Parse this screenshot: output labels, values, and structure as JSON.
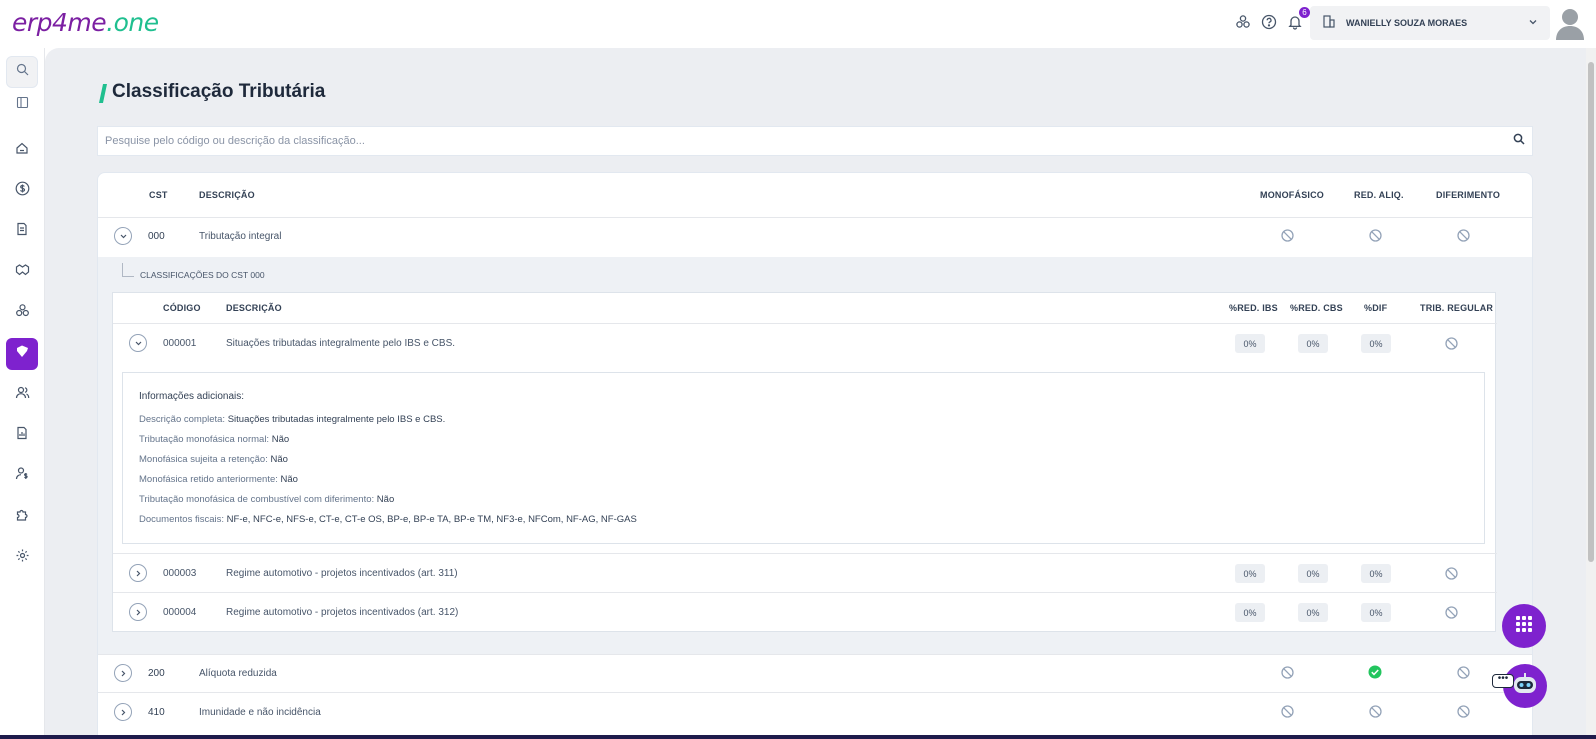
{
  "app": {
    "logo_part1": "erp4me",
    "logo_part2": ".one"
  },
  "topbar": {
    "notifications_count": "6",
    "user_name": "WANIELLY SOUZA MORAES"
  },
  "page": {
    "title": "Classificação Tributária",
    "search_placeholder": "Pesquise pelo código ou descrição da classificação..."
  },
  "table": {
    "headers": {
      "cst": "CST",
      "descricao": "DESCRIÇÃO",
      "monofasico": "MONOFÁSICO",
      "red_aliq": "RED. ALIQ.",
      "diferimento": "DIFERIMENTO"
    },
    "rows": [
      {
        "cst": "000",
        "descricao": "Tributação integral",
        "monofasico": "no",
        "red_aliq": "no",
        "diferimento": "no",
        "expanded": true
      },
      {
        "cst": "200",
        "descricao": "Alíquota reduzida",
        "monofasico": "no",
        "red_aliq": "yes",
        "diferimento": "no",
        "expanded": false
      },
      {
        "cst": "410",
        "descricao": "Imunidade e não incidência",
        "monofasico": "no",
        "red_aliq": "no",
        "diferimento": "no",
        "expanded": false
      }
    ]
  },
  "sub": {
    "label": "CLASSIFICAÇÕES DO CST 000",
    "headers": {
      "codigo": "CÓDIGO",
      "descricao": "DESCRIÇÃO",
      "red_ibs": "%RED. IBS",
      "red_cbs": "%RED. CBS",
      "dif": "%DIF",
      "trib_regular": "TRIB. REGULAR"
    },
    "rows": [
      {
        "codigo": "000001",
        "descricao": "Situações tributadas integralmente pelo IBS e CBS.",
        "red_ibs": "0%",
        "red_cbs": "0%",
        "dif": "0%"
      },
      {
        "codigo": "000003",
        "descricao": "Regime automotivo - projetos incentivados (art. 311)",
        "red_ibs": "0%",
        "red_cbs": "0%",
        "dif": "0%"
      },
      {
        "codigo": "000004",
        "descricao": "Regime automotivo - projetos incentivados (art. 312)",
        "red_ibs": "0%",
        "red_cbs": "0%",
        "dif": "0%"
      }
    ],
    "info": {
      "title": "Informações adicionais:",
      "lines": [
        {
          "label": "Descrição completa:",
          "value": "Situações tributadas integralmente pelo IBS e CBS."
        },
        {
          "label": "Tributação monofásica normal:",
          "value": "Não"
        },
        {
          "label": "Monofásica sujeita a retenção:",
          "value": "Não"
        },
        {
          "label": "Monofásica retido anteriormente:",
          "value": "Não"
        },
        {
          "label": "Tributação monofásica de combustível com diferimento:",
          "value": "Não"
        },
        {
          "label": "Documentos fiscais:",
          "value": "NF-e, NFC-e, NFS-e, CT-e, CT-e OS, BP-e, BP-e TA, BP-e TM, NF3-e, NFCom, NF-AG, NF-GAS"
        }
      ]
    }
  },
  "colors": {
    "brand_purple": "#7e22ce",
    "brand_green": "#1fbf8f",
    "ok_green": "#22c55e"
  }
}
